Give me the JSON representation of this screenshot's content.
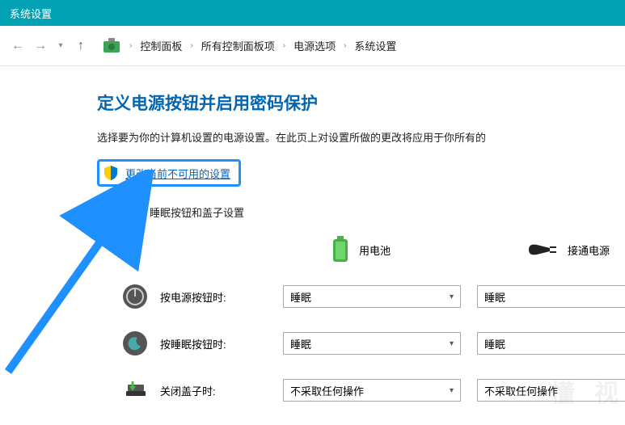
{
  "title_bar": {
    "title": "系统设置"
  },
  "breadcrumb": {
    "items": [
      "控制面板",
      "所有控制面板项",
      "电源选项",
      "系统设置"
    ]
  },
  "page": {
    "title": "定义电源按钮并启用密码保护",
    "description": "选择要为你的计算机设置的电源设置。在此页上对设置所做的更改将应用于你所有的",
    "unavailable_link": "更改当前不可用的设置",
    "section_title": "电源按钮、睡眠按钮和盖子设置"
  },
  "columns": {
    "battery": "用电池",
    "plugged": "接通电源"
  },
  "rows": {
    "power_button": {
      "label": "按电源按钮时:",
      "battery": "睡眠",
      "plugged": "睡眠"
    },
    "sleep_button": {
      "label": "按睡眠按钮时:",
      "battery": "睡眠",
      "plugged": "睡眠"
    },
    "lid_close": {
      "label": "关闭盖子时:",
      "battery": "不采取任何操作",
      "plugged": "不采取任何操作"
    }
  },
  "watermark": "懂  视"
}
